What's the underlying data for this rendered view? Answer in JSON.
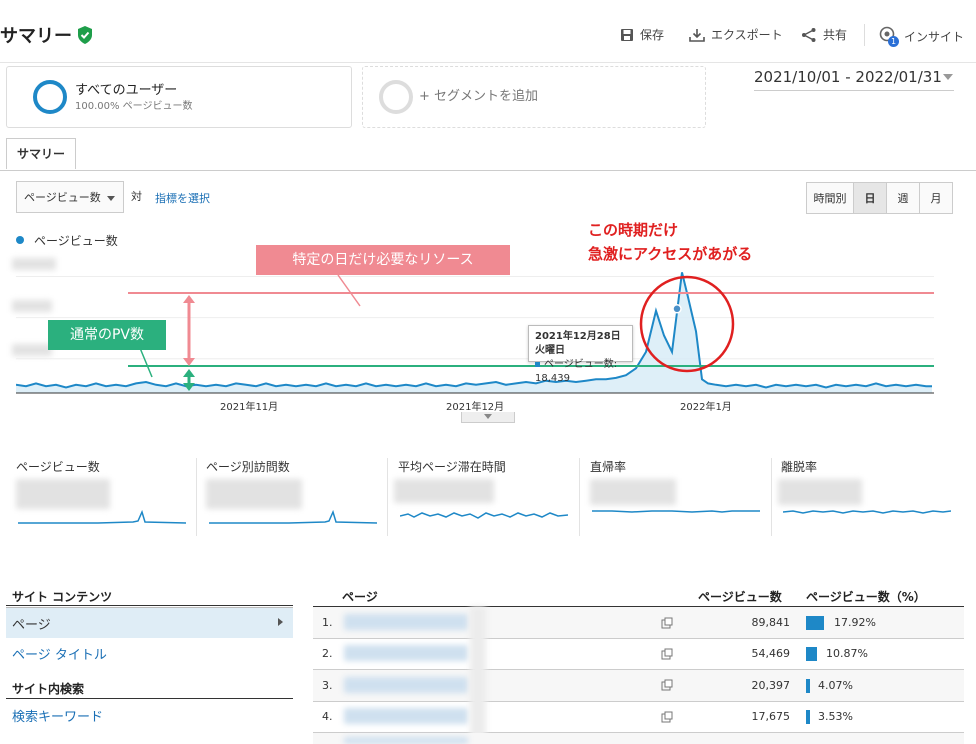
{
  "header": {
    "title": "サマリー",
    "save_label": "保存",
    "export_label": "エクスポート",
    "share_label": "共有",
    "insight_label": "インサイト",
    "insight_badge": "1"
  },
  "segments": [
    {
      "title": "すべてのユーザー",
      "subtitle": "100.00% ページビュー数"
    },
    {
      "title": "+ セグメントを追加"
    }
  ],
  "date_range": "2021/10/01 - 2022/01/31",
  "tab": "サマリー",
  "controls": {
    "metric_select": "ページビュー数",
    "vs": "対",
    "choose_metric": "指標を選択",
    "granularity": [
      "時間別",
      "日",
      "週",
      "月"
    ],
    "granularity_selected": "日"
  },
  "chart": {
    "legend": "ページビュー数",
    "x_labels": [
      "2021年11月",
      "2021年12月",
      "2022年1月"
    ],
    "tooltip_date": "2021年12月28日火曜日",
    "tooltip_value": "ページビュー数: 18,439"
  },
  "chart_data": {
    "type": "area",
    "series": [
      {
        "name": "ページビュー数",
        "points": [
          [
            0,
            0.06
          ],
          [
            10,
            0.05
          ],
          [
            20,
            0.07
          ],
          [
            30,
            0.05
          ],
          [
            40,
            0.06
          ],
          [
            50,
            0.04
          ],
          [
            60,
            0.06
          ],
          [
            70,
            0.05
          ],
          [
            80,
            0.07
          ],
          [
            90,
            0.05
          ],
          [
            100,
            0.06
          ],
          [
            110,
            0.05
          ],
          [
            120,
            0.07
          ],
          [
            130,
            0.08
          ],
          [
            140,
            0.06
          ],
          [
            150,
            0.05
          ],
          [
            160,
            0.07
          ],
          [
            170,
            0.05
          ],
          [
            180,
            0.06
          ],
          [
            190,
            0.05
          ],
          [
            200,
            0.06
          ],
          [
            210,
            0.05
          ],
          [
            220,
            0.07
          ],
          [
            230,
            0.06
          ],
          [
            240,
            0.05
          ],
          [
            250,
            0.07
          ],
          [
            260,
            0.05
          ],
          [
            270,
            0.06
          ],
          [
            280,
            0.05
          ],
          [
            290,
            0.06
          ],
          [
            300,
            0.05
          ],
          [
            310,
            0.07
          ],
          [
            320,
            0.05
          ],
          [
            330,
            0.06
          ],
          [
            340,
            0.05
          ],
          [
            350,
            0.07
          ],
          [
            360,
            0.05
          ],
          [
            370,
            0.06
          ],
          [
            380,
            0.05
          ],
          [
            390,
            0.06
          ],
          [
            400,
            0.05
          ],
          [
            410,
            0.07
          ],
          [
            420,
            0.05
          ],
          [
            430,
            0.06
          ],
          [
            440,
            0.05
          ],
          [
            450,
            0.07
          ],
          [
            460,
            0.06
          ],
          [
            470,
            0.07
          ],
          [
            480,
            0.08
          ],
          [
            490,
            0.06
          ],
          [
            500,
            0.07
          ],
          [
            510,
            0.08
          ],
          [
            520,
            0.07
          ],
          [
            530,
            0.09
          ],
          [
            540,
            0.08
          ],
          [
            550,
            0.09
          ],
          [
            560,
            0.08
          ],
          [
            570,
            0.09
          ],
          [
            580,
            0.1
          ],
          [
            590,
            0.1
          ],
          [
            600,
            0.11
          ],
          [
            610,
            0.13
          ],
          [
            620,
            0.18
          ],
          [
            630,
            0.3
          ],
          [
            640,
            0.6
          ],
          [
            648,
            0.42
          ],
          [
            656,
            0.3
          ],
          [
            666,
            0.88
          ],
          [
            672,
            0.7
          ],
          [
            680,
            0.45
          ],
          [
            686,
            0.1
          ],
          [
            692,
            0.07
          ],
          [
            700,
            0.06
          ],
          [
            710,
            0.05
          ],
          [
            720,
            0.06
          ],
          [
            730,
            0.05
          ],
          [
            740,
            0.06
          ],
          [
            750,
            0.04
          ],
          [
            760,
            0.06
          ],
          [
            770,
            0.05
          ],
          [
            780,
            0.06
          ],
          [
            790,
            0.05
          ],
          [
            800,
            0.06
          ],
          [
            810,
            0.04
          ],
          [
            820,
            0.06
          ],
          [
            830,
            0.05
          ],
          [
            840,
            0.06
          ],
          [
            850,
            0.05
          ],
          [
            860,
            0.07
          ],
          [
            870,
            0.05
          ],
          [
            880,
            0.06
          ],
          [
            890,
            0.05
          ],
          [
            900,
            0.06
          ],
          [
            910,
            0.05
          ],
          [
            916,
            0.05
          ]
        ]
      }
    ],
    "peak": {
      "date": "2021年12月28日火曜日",
      "value": 18439
    }
  },
  "annotations": {
    "peak_note_line1": "この時期だけ",
    "peak_note_line2": "急激にアクセスがあがる",
    "resource_note": "特定の日だけ必要なリソース",
    "normal_note": "通常のPV数",
    "colors": {
      "red": "#e02020",
      "pink": "#f08a92",
      "green": "#2bb07e",
      "blue": "#1e88c7"
    }
  },
  "metrics": [
    {
      "label": "ページビュー数"
    },
    {
      "label": "ページ別訪問数"
    },
    {
      "label": "平均ページ滞在時間"
    },
    {
      "label": "直帰率"
    },
    {
      "label": "離脱率"
    }
  ],
  "site_content": {
    "heading": "サイト コンテンツ",
    "items": [
      "ページ",
      "ページ タイトル"
    ],
    "search_heading": "サイト内検索",
    "search_items": [
      "検索キーワード"
    ]
  },
  "table": {
    "headers": [
      "ページ",
      "ページビュー数",
      "ページビュー数（%）"
    ],
    "rows": [
      {
        "num": "1.",
        "pv": "89,841",
        "pct": "17.92%",
        "share": 17.92
      },
      {
        "num": "2.",
        "pv": "54,469",
        "pct": "10.87%",
        "share": 10.87
      },
      {
        "num": "3.",
        "pv": "20,397",
        "pct": "4.07%",
        "share": 4.07
      },
      {
        "num": "4.",
        "pv": "17,675",
        "pct": "3.53%",
        "share": 3.53
      }
    ]
  }
}
